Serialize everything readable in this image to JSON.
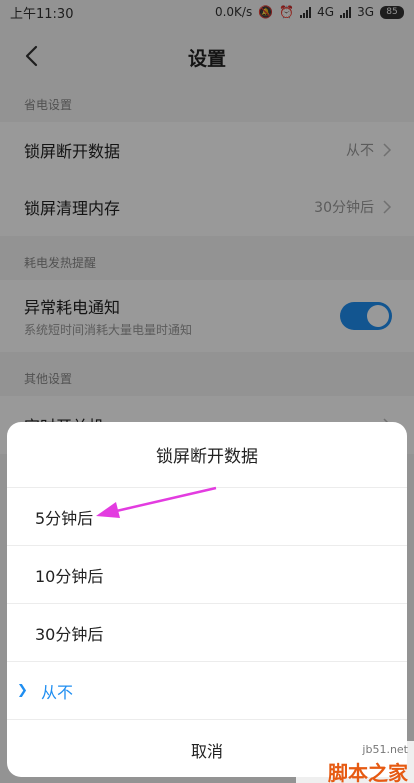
{
  "status_bar": {
    "time": "上午11:30",
    "net_speed": "0.0K/s",
    "net1": "4G",
    "net2": "3G",
    "battery": "85"
  },
  "header": {
    "title": "设置"
  },
  "sections": {
    "power_save": {
      "header": "省电设置",
      "rows": [
        {
          "label": "锁屏断开数据",
          "value": "从不"
        },
        {
          "label": "锁屏清理内存",
          "value": "30分钟后"
        }
      ]
    },
    "heat": {
      "header": "耗电发热提醒",
      "rows": [
        {
          "label": "异常耗电通知",
          "sub": "系统短时间消耗大量电量时通知",
          "toggle_on": true
        }
      ]
    },
    "other": {
      "header": "其他设置",
      "rows": [
        {
          "label": "定时开关机"
        }
      ]
    }
  },
  "dialog": {
    "title": "锁屏断开数据",
    "options": [
      "5分钟后",
      "10分钟后",
      "30分钟后",
      "从不"
    ],
    "selected_index": 3,
    "cancel": "取消"
  },
  "watermark": {
    "site": "jb51.net",
    "text": "脚本之家"
  },
  "colors": {
    "accent": "#1f8ef1",
    "annotation": "#e33ce0"
  }
}
